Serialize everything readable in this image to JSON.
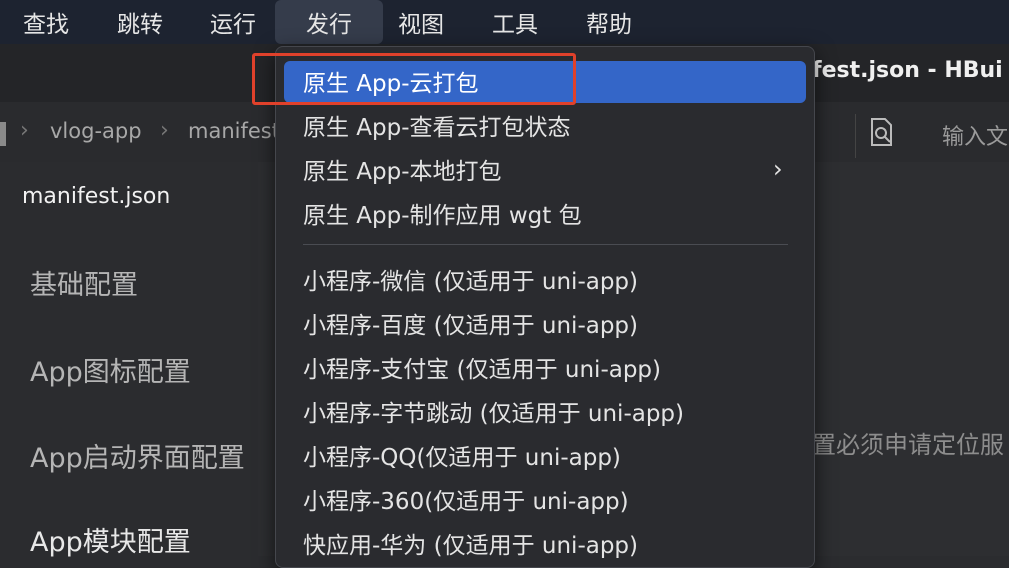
{
  "menubar": {
    "items": [
      {
        "label": "查找"
      },
      {
        "label": "跳转"
      },
      {
        "label": "运行"
      },
      {
        "label": "发行"
      },
      {
        "label": "视图"
      },
      {
        "label": "工具"
      },
      {
        "label": "帮助"
      }
    ]
  },
  "window": {
    "title": "fest.json - HBui"
  },
  "breadcrumb": {
    "items": [
      "vlog-app",
      "manifest"
    ]
  },
  "search": {
    "placeholder": "输入文"
  },
  "editor": {
    "file_tab": "manifest.json"
  },
  "sidebar": {
    "items": [
      {
        "label": "基础配置"
      },
      {
        "label": "App图标配置"
      },
      {
        "label": "App启动界面配置"
      },
      {
        "label": "App模块配置"
      }
    ]
  },
  "content": {
    "partial_text": "置必须申请定位服"
  },
  "dropdown": {
    "items": [
      {
        "label": "原生 App-云打包",
        "highlighted": true
      },
      {
        "label": "原生 App-查看云打包状态"
      },
      {
        "label": "原生 App-本地打包",
        "has_submenu": true
      },
      {
        "label": "原生 App-制作应用 wgt 包"
      },
      {
        "label": "小程序-微信 (仅适用于 uni-app)"
      },
      {
        "label": "小程序-百度 (仅适用于 uni-app)"
      },
      {
        "label": "小程序-支付宝 (仅适用于 uni-app)"
      },
      {
        "label": "小程序-字节跳动 (仅适用于 uni-app)"
      },
      {
        "label": "小程序-QQ(仅适用于 uni-app)"
      },
      {
        "label": "小程序-360(仅适用于 uni-app)"
      },
      {
        "label": "快应用-华为 (仅适用于 uni-app)"
      }
    ]
  },
  "colors": {
    "accent": "#3466c8",
    "annotation": "#e0412b",
    "menubar": "#1d2330"
  }
}
